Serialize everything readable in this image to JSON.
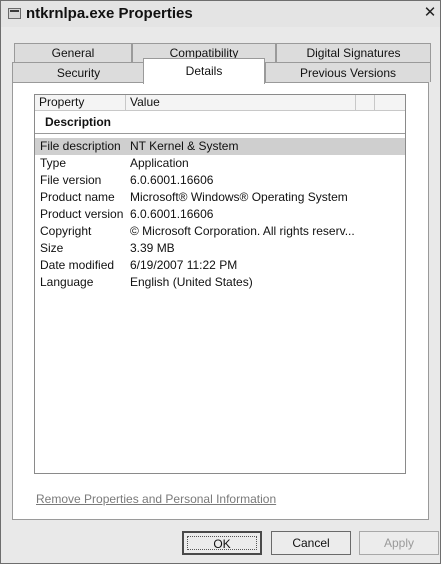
{
  "window": {
    "title": "ntkrnlpa.exe Properties",
    "close_glyph": "✕"
  },
  "tabs": {
    "row1": [
      {
        "label": "General"
      },
      {
        "label": "Compatibility"
      },
      {
        "label": "Digital Signatures"
      }
    ],
    "row2": [
      {
        "label": "Security"
      },
      {
        "label": "Details",
        "active": true
      },
      {
        "label": "Previous Versions"
      }
    ]
  },
  "list": {
    "headers": {
      "property": "Property",
      "value": "Value"
    },
    "group_title": "Description",
    "rows": [
      {
        "property": "File description",
        "value": "NT Kernel & System",
        "selected": true
      },
      {
        "property": "Type",
        "value": "Application"
      },
      {
        "property": "File version",
        "value": "6.0.6001.16606"
      },
      {
        "property": "Product name",
        "value": "Microsoft® Windows® Operating System"
      },
      {
        "property": "Product version",
        "value": "6.0.6001.16606"
      },
      {
        "property": "Copyright",
        "value": "© Microsoft Corporation. All rights reserv..."
      },
      {
        "property": "Size",
        "value": "3.39 MB"
      },
      {
        "property": "Date modified",
        "value": "6/19/2007 11:22 PM"
      },
      {
        "property": "Language",
        "value": "English (United States)"
      }
    ]
  },
  "remove_link": "Remove Properties and Personal Information",
  "buttons": {
    "ok": "OK",
    "cancel": "Cancel",
    "apply": "Apply"
  }
}
